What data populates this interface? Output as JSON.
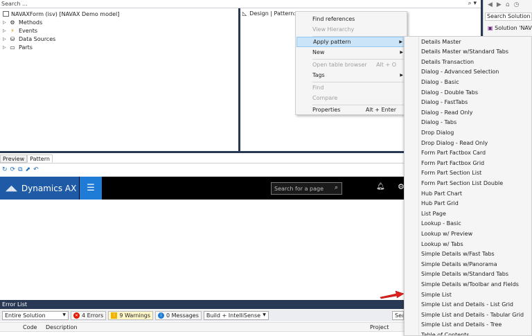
{
  "top_search": {
    "placeholder": "Search ...",
    "icon": "search-icon"
  },
  "tree": {
    "root": "NAVAXForm (isv) [NAVAX Demo model]",
    "items": [
      {
        "label": "Methods",
        "icon": "methods-icon"
      },
      {
        "label": "Events",
        "icon": "events-icon"
      },
      {
        "label": "Data Sources",
        "icon": "data-sources-icon"
      },
      {
        "label": "Parts",
        "icon": "parts-icon"
      }
    ]
  },
  "design_header": {
    "label": "Design | Pattern:"
  },
  "context_menu": {
    "items": [
      {
        "label": "Find references",
        "disabled": false
      },
      {
        "label": "View Hierarchy",
        "disabled": true
      },
      {
        "label": "Apply pattern",
        "highlighted": true,
        "submenu": true
      },
      {
        "label": "New",
        "submenu": true
      },
      {
        "label": "Open table browser",
        "disabled": true,
        "shortcut": "Alt + O"
      },
      {
        "label": "Tags",
        "submenu": true
      },
      {
        "label": "Find",
        "disabled": true
      },
      {
        "label": "Compare",
        "disabled": true
      },
      {
        "label": "Properties",
        "shortcut": "Alt + Enter"
      }
    ]
  },
  "pattern_submenu": {
    "items": [
      "Details Master",
      "Details Master w/Standard Tabs",
      "Details Transaction",
      "Dialog - Advanced Selection",
      "Dialog - Basic",
      "Dialog - Double Tabs",
      "Dialog - FastTabs",
      "Dialog - Read Only",
      "Dialog - Tabs",
      "Drop Dialog",
      "Drop Dialog - Read Only",
      "Form Part Factbox Card",
      "Form Part Factbox Grid",
      "Form Part Section List",
      "Form Part Section List Double",
      "Hub Part Chart",
      "Hub Part Grid",
      "List Page",
      "Lookup - Basic",
      "Lookup w/ Preview",
      "Lookup w/ Tabs",
      "Simple Details w/Fast Tabs",
      "Simple Details w/Panorama",
      "Simple Details w/Standard Tabs",
      "Simple Details w/Toolbar and Fields",
      "Simple List",
      "Simple List and Details - List Grid",
      "Simple List and Details - Tabular Grid",
      "Simple List and Details - Tree",
      "Table of Contents"
    ]
  },
  "solution_explorer": {
    "search_placeholder": "Search Solution Ex",
    "item": "Solution 'NAV"
  },
  "preview_tabs": [
    "Preview",
    "Pattern"
  ],
  "dynamics": {
    "brand": "Dynamics AX",
    "search_placeholder": "Search for a page",
    "bell_icon": "bell-icon",
    "gear_icon": "gear-icon"
  },
  "error_list": {
    "title": "Error List",
    "scope": "Entire Solution",
    "errors": "4 Errors",
    "warnings": "9 Warnings",
    "messages": "0 Messages",
    "build_filter": "Build + IntelliSense",
    "search_stub": "Sear",
    "columns": [
      "Code",
      "Description",
      "Project"
    ]
  },
  "colors": {
    "accent": "#1e7bd6",
    "brand": "#1f5aa6",
    "chrome": "#293955",
    "highlight": "#cce4f7",
    "arrow": "#e02020"
  }
}
